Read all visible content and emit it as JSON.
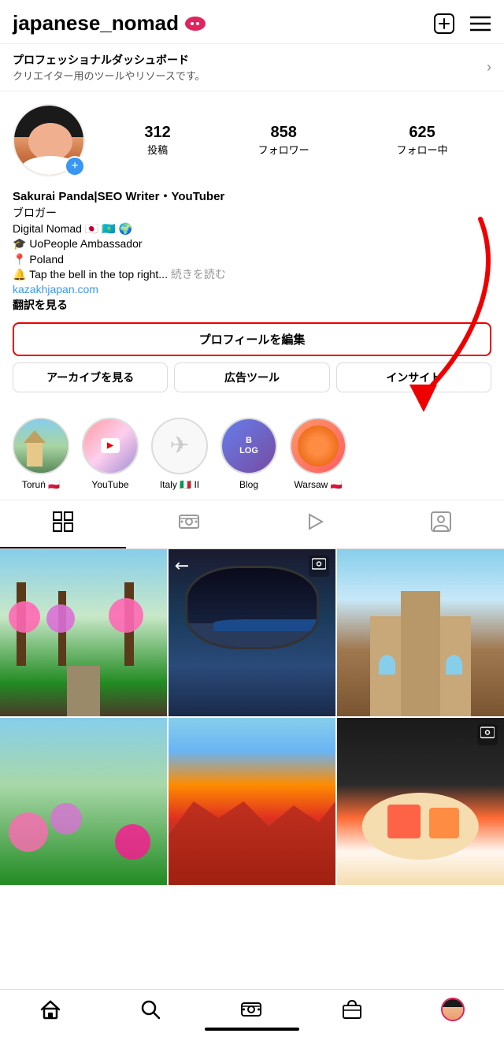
{
  "header": {
    "username": "japanese_nomad",
    "add_icon": "➕",
    "menu_icon": "☰"
  },
  "dashboard": {
    "title": "プロフェッショナルダッシュボード",
    "subtitle": "クリエイター用のツールやリソースです。"
  },
  "profile": {
    "display_name": "Sakurai Panda|SEO Writer・YouTuber",
    "occupation": "ブロガー",
    "bio_line1": "Digital Nomad 🇯🇵 🇰🇿 🌍",
    "bio_line2": "🎓 UoPeople Ambassador",
    "bio_line3": "📍 Poland",
    "bio_line4": "🔔 Tap the bell in the top right...",
    "continue_reading": "続きを読む",
    "link": "kazakhjapan.com",
    "translate": "翻訳を見る",
    "stats": {
      "posts_count": "312",
      "posts_label": "投稿",
      "followers_count": "858",
      "followers_label": "フォロワー",
      "following_count": "625",
      "following_label": "フォロー中"
    }
  },
  "buttons": {
    "edit_profile": "プロフィールを編集",
    "archive": "アーカイブを見る",
    "ad_tools": "広告ツール",
    "insights": "インサイト"
  },
  "highlights": [
    {
      "id": "torun",
      "label": "Toruń 🇵🇱",
      "style": "hl-torun"
    },
    {
      "id": "youtube",
      "label": "YouTube",
      "style": "hl-youtube"
    },
    {
      "id": "italy",
      "label": "Italy 🇮🇹 II",
      "style": "hl-italy",
      "icon": "✈"
    },
    {
      "id": "blog",
      "label": "Blog",
      "style": "hl-blog"
    },
    {
      "id": "warsaw",
      "label": "Warsaw 🇵🇱",
      "style": "hl-warsaw"
    }
  ],
  "tabs": [
    {
      "id": "grid",
      "icon": "⊞",
      "active": true
    },
    {
      "id": "reels",
      "icon": "▶",
      "active": false
    },
    {
      "id": "clips",
      "icon": "▷",
      "active": false
    },
    {
      "id": "tagged",
      "icon": "◫",
      "active": false
    }
  ],
  "grid": {
    "items": [
      {
        "id": "photo1",
        "style": "photo-park",
        "has_reel": false
      },
      {
        "id": "photo2",
        "style": "photo-plane",
        "has_reel": true
      },
      {
        "id": "photo3",
        "style": "photo-church",
        "has_reel": false
      },
      {
        "id": "photo4",
        "style": "photo-flowers",
        "has_reel": false
      },
      {
        "id": "photo5",
        "style": "photo-city",
        "has_reel": false
      },
      {
        "id": "photo6",
        "style": "photo-sushi",
        "has_reel": true
      }
    ]
  },
  "bottom_nav": {
    "home": "🏠",
    "search": "🔍",
    "reels": "▶",
    "shop": "🛍",
    "profile": "avatar"
  },
  "colors": {
    "accent_red": "#e00000",
    "instagram_blue": "#3897f0",
    "highlight_border": "#dbdbdb"
  }
}
